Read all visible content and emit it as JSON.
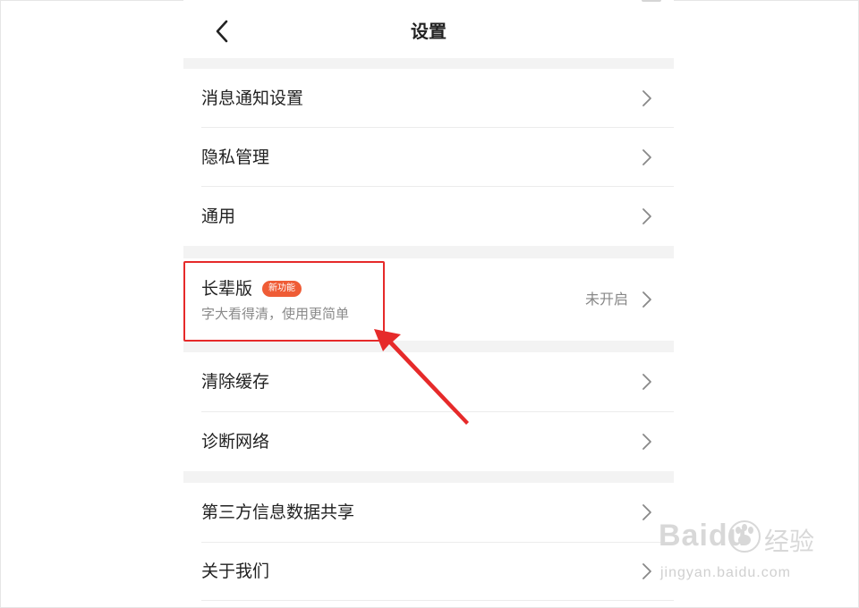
{
  "header": {
    "title": "设置",
    "back_icon": "chevron-left-icon"
  },
  "settings": {
    "notification": "消息通知设置",
    "privacy": "隐私管理",
    "general": "通用",
    "elder_mode": {
      "title": "长辈版",
      "badge": "新功能",
      "subtitle": "字大看得清，使用更简单",
      "status": "未开启"
    },
    "clear_cache": "清除缓存",
    "diagnose_network": "诊断网络",
    "third_party_sharing": "第三方信息数据共享",
    "about_us": "关于我们"
  },
  "watermark": {
    "brand": "Baidu",
    "cn": "经验",
    "url": "jingyan.baidu.com"
  },
  "colors": {
    "accent": "#ef5c36",
    "annotation": "#e62a2a",
    "section_gap": "#f3f3f3"
  }
}
